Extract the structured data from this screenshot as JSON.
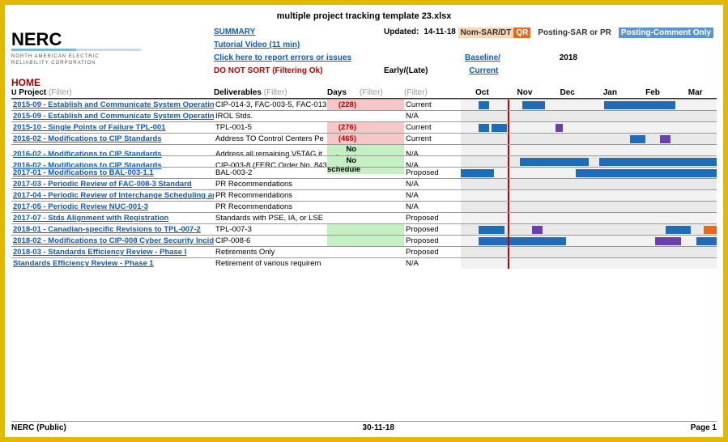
{
  "doc_title": "multiple project tracking template 23.xlsx",
  "logo": {
    "name": "NERC",
    "sub1": "NORTH AMERICAN ELECTRIC",
    "sub2": "RELIABILITY CORPORATION"
  },
  "hdr": {
    "summary": "SUMMARY",
    "updated_label": "Updated:",
    "updated_value": "14-11-18",
    "tutorial": "Tutorial Video (11 min)",
    "report": "Click here to report errors or issues",
    "sort_warn": "DO NOT SORT (Filtering Ok)",
    "baseline": "Baseline/",
    "current": "Current",
    "early_late": "Early/(Late)",
    "days": "Days",
    "home": "HOME",
    "u": "U",
    "project_hd": "Project",
    "deliv_hd": "Deliverables",
    "filter_txt": "(Filter)",
    "year": "2018",
    "months": [
      "Oct",
      "Nov",
      "Dec",
      "Jan",
      "Feb",
      "Mar"
    ]
  },
  "legend": {
    "nomsar": "Nom-SAR/DT",
    "qr": "QR",
    "posting": "Posting-SAR or PR",
    "comment": "Posting-Comment Only"
  },
  "rows": [
    {
      "project": "2015-09 - Establish and Communicate System Operating",
      "deliv": "CIP-014-3, FAC-003-5, FAC-013",
      "days": "(228)",
      "days_bg": "pink",
      "status": "Current",
      "bars": [
        {
          "l": 7,
          "w": 4
        },
        {
          "l": 24,
          "w": 9
        },
        {
          "l": 56,
          "w": 28
        }
      ]
    },
    {
      "project": "2015-09 - Establish and Communicate System Operating",
      "deliv": "IROL Stds.",
      "days": "",
      "status": "N/A",
      "bars": []
    },
    {
      "project": "2015-10 - Single Points of Failure TPL-001",
      "deliv": "TPL-001-5",
      "days": "(276)",
      "days_bg": "pink",
      "status": "Current",
      "bars": [
        {
          "l": 7,
          "w": 4
        },
        {
          "l": 12,
          "w": 6
        },
        {
          "l": 37,
          "w": 3,
          "c": "purple"
        }
      ]
    },
    {
      "project": "2016-02 - Modifications to CIP Standards",
      "deliv": "Address TO Control Centers Pe",
      "days": "(465)",
      "days_bg": "pink",
      "status": "Current",
      "bars": [
        {
          "l": 66,
          "w": 6
        },
        {
          "l": 78,
          "w": 4,
          "c": "purple"
        }
      ]
    },
    {
      "project": "2016-02 - Modifications to CIP Standards",
      "deliv": "Address all remaining V5TAG it",
      "days": "No schedule",
      "days_bg": "green",
      "status": "N/A",
      "bars": []
    },
    {
      "project": "2016-02 - Modifications to CIP Standards",
      "deliv": "CIP-003-8 (FERC Order No. 843)",
      "days": "No schedule",
      "days_bg": "green",
      "status": "N/A",
      "bars": [
        {
          "l": 23,
          "w": 27
        },
        {
          "l": 54,
          "w": 46
        }
      ]
    },
    {
      "project": "2017-01 - Modifications to BAL-003-1.1",
      "deliv": "BAL-003-2",
      "days": "",
      "status": "Proposed",
      "bars": [
        {
          "l": 0,
          "w": 13
        },
        {
          "l": 45,
          "w": 55
        }
      ]
    },
    {
      "project": "2017-03 - Periodic Review of FAC-008-3 Standard",
      "deliv": "PR Recommendations",
      "days": "",
      "status": "N/A",
      "bars": []
    },
    {
      "project": "2017-04 - Periodic Review of Interchange Scheduling an",
      "deliv": "PR Recommendations",
      "days": "",
      "status": "N/A",
      "bars": []
    },
    {
      "project": "2017-05 - Periodic Review NUC-001-3",
      "deliv": "PR Recommendations",
      "days": "",
      "status": "N/A",
      "bars": []
    },
    {
      "project": "2017-07 - Stds Alignment with Registration",
      "deliv": "Standards with PSE, IA, or LSE",
      "days": "",
      "status": "Proposed",
      "bars": []
    },
    {
      "project": "2018-01 - Canadian-specific Revisions to TPL-007-2",
      "deliv": "TPL-007-3",
      "days": "",
      "days_bg": "green",
      "status": "Proposed",
      "bars": [
        {
          "l": 7,
          "w": 10
        },
        {
          "l": 28,
          "w": 4,
          "c": "purple"
        },
        {
          "l": 80,
          "w": 10
        },
        {
          "l": 95,
          "w": 5,
          "c": "orange"
        }
      ]
    },
    {
      "project": "2018-02 - Modifications to CIP-008 Cyber Security Incide",
      "deliv": "CIP-008-6",
      "days": "",
      "days_bg": "green",
      "status": "Proposed",
      "bars": [
        {
          "l": 7,
          "w": 34
        },
        {
          "l": 76,
          "w": 10,
          "c": "purple"
        },
        {
          "l": 92,
          "w": 8
        }
      ]
    },
    {
      "project": "2018-03 - Standards Efficiency Review - Phase I",
      "deliv": "Retirements Only",
      "days": "",
      "status": "Proposed",
      "bars": []
    },
    {
      "project": "Standards Efficiency Review - Phase 1",
      "deliv": "Retirement of various requirem",
      "days": "",
      "status": "N/A",
      "bars": []
    }
  ],
  "footer": {
    "left": "NERC (Public)",
    "center": "30-11-18",
    "right": "Page 1"
  }
}
